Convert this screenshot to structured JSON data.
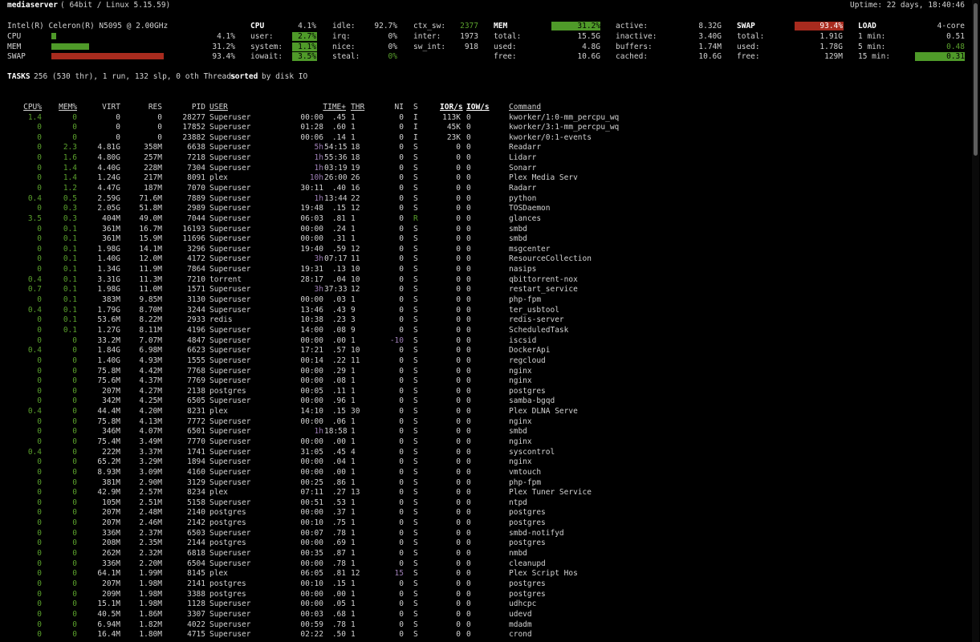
{
  "header": {
    "hostname": "mediaserver",
    "system": "( 64bit / Linux 5.15.59)",
    "uptime": "Uptime: 22 days, 18:40:46"
  },
  "quicklook": {
    "cpu_name": "Intel(R) Celeron(R) N5095 @ 2.00GHz",
    "rows": [
      {
        "label": "CPU",
        "value": "4.1%",
        "fraction": 0.041
      },
      {
        "label": "MEM",
        "value": "31.2%",
        "fraction": 0.312
      },
      {
        "label": "SWAP",
        "value": "93.4%",
        "fraction": 0.934
      }
    ]
  },
  "cpu": {
    "title": "CPU",
    "total": "4.1%",
    "user_label": "user:",
    "user": "2.7%",
    "system_label": "system:",
    "system": "1.1%",
    "iowait_label": "iowait:",
    "iowait": "3.5%",
    "idle_label": "idle:",
    "idle": "92.7%",
    "irq_label": "irq:",
    "irq": "0%",
    "nice_label": "nice:",
    "nice": "0%",
    "steal_label": "steal:",
    "steal": "0%",
    "ctx_label": "ctx_sw:",
    "ctx": "2377",
    "inter_label": "inter:",
    "inter": "1973",
    "swint_label": "sw_int:",
    "swint": "918"
  },
  "mem": {
    "title": "MEM",
    "pct": "31.2%",
    "total_label": "total:",
    "total": "15.5G",
    "used_label": "used:",
    "used": "4.8G",
    "free_label": "free:",
    "free": "10.6G",
    "active_label": "active:",
    "active": "8.32G",
    "inactive_label": "inactive:",
    "inactive": "3.40G",
    "buffers_label": "buffers:",
    "buffers": "1.74M",
    "cached_label": "cached:",
    "cached": "10.6G"
  },
  "swap": {
    "title": "SWAP",
    "pct": "93.4%",
    "total_label": "total:",
    "total": "1.91G",
    "used_label": "used:",
    "used": "1.78G",
    "free_label": "free:",
    "free": "129M"
  },
  "load": {
    "title": "LOAD",
    "cores": "4-core",
    "m1_label": "1 min:",
    "m1": "0.51",
    "m5_label": "5 min:",
    "m5": "0.48",
    "m15_label": "15 min:",
    "m15": "0.31"
  },
  "colors": {
    "green": "#5aa02c",
    "red": "#a82b1e",
    "bar_green": "#4f9a29"
  },
  "tasks": {
    "label": "TASKS",
    "summary": "256 (530 thr), 1 run, 132 slp, 0 oth Threads",
    "sorted": "sorted",
    "sort_key": "by disk IO"
  },
  "columns": [
    "CPU%",
    "MEM%",
    "VIRT",
    "RES",
    "PID",
    "USER",
    "TIME+",
    "THR",
    "NI",
    "S",
    "IOR/s",
    "IOW/s",
    "Command"
  ],
  "processes": [
    [
      "1.4",
      "0",
      "0",
      "0",
      "28277",
      "Superuser",
      "00:00",
      ".45",
      "1",
      "0",
      "I",
      "113K",
      "0",
      "kworker/1:0-mm_percpu_wq"
    ],
    [
      "0",
      "0",
      "0",
      "0",
      "17852",
      "Superuser",
      "01:28",
      ".60",
      "1",
      "0",
      "I",
      "45K",
      "0",
      "kworker/3:1-mm_percpu_wq"
    ],
    [
      "0",
      "0",
      "0",
      "0",
      "23882",
      "Superuser",
      "00:06",
      ".14",
      "1",
      "0",
      "I",
      "23K",
      "0",
      "kworker/0:1-events"
    ],
    [
      "0",
      "2.3",
      "4.81G",
      "358M",
      "6638",
      "Superuser",
      "5h",
      "54:15",
      "18",
      "0",
      "S",
      "0",
      "0",
      "Readarr"
    ],
    [
      "0",
      "1.6",
      "4.80G",
      "257M",
      "7218",
      "Superuser",
      "1h",
      "55:36",
      "18",
      "0",
      "S",
      "0",
      "0",
      "Lidarr"
    ],
    [
      "0",
      "1.4",
      "4.40G",
      "228M",
      "7304",
      "Superuser",
      "1h",
      "03:19",
      "19",
      "0",
      "S",
      "0",
      "0",
      "Sonarr"
    ],
    [
      "0",
      "1.4",
      "1.24G",
      "217M",
      "8091",
      "plex",
      "10h",
      "26:00",
      "26",
      "0",
      "S",
      "0",
      "0",
      "Plex Media Serv"
    ],
    [
      "0",
      "1.2",
      "4.47G",
      "187M",
      "7070",
      "Superuser",
      "30:11",
      ".40",
      "16",
      "0",
      "S",
      "0",
      "0",
      "Radarr"
    ],
    [
      "0.4",
      "0.5",
      "2.59G",
      "71.6M",
      "7889",
      "Superuser",
      "1h",
      "13:44",
      "22",
      "0",
      "S",
      "0",
      "0",
      "python"
    ],
    [
      "0",
      "0.3",
      "2.05G",
      "51.8M",
      "2989",
      "Superuser",
      "19:48",
      ".15",
      "12",
      "0",
      "S",
      "0",
      "0",
      "TOSDaemon"
    ],
    [
      "3.5",
      "0.3",
      "404M",
      "49.0M",
      "7044",
      "Superuser",
      "06:03",
      ".81",
      "1",
      "0",
      "R",
      "0",
      "0",
      "glances"
    ],
    [
      "0",
      "0.1",
      "361M",
      "16.7M",
      "16193",
      "Superuser",
      "00:00",
      ".24",
      "1",
      "0",
      "S",
      "0",
      "0",
      "smbd"
    ],
    [
      "0",
      "0.1",
      "361M",
      "15.9M",
      "11696",
      "Superuser",
      "00:00",
      ".31",
      "1",
      "0",
      "S",
      "0",
      "0",
      "smbd"
    ],
    [
      "0",
      "0.1",
      "1.98G",
      "14.1M",
      "3296",
      "Superuser",
      "19:40",
      ".59",
      "12",
      "0",
      "S",
      "0",
      "0",
      "msgcenter"
    ],
    [
      "0",
      "0.1",
      "1.40G",
      "12.0M",
      "4172",
      "Superuser",
      "3h",
      "07:17",
      "11",
      "0",
      "S",
      "0",
      "0",
      "ResourceCollection"
    ],
    [
      "0",
      "0.1",
      "1.34G",
      "11.9M",
      "7864",
      "Superuser",
      "19:31",
      ".13",
      "10",
      "0",
      "S",
      "0",
      "0",
      "nasips"
    ],
    [
      "0.4",
      "0.1",
      "3.31G",
      "11.3M",
      "7210",
      "torrent",
      "28:17",
      ".04",
      "10",
      "0",
      "S",
      "0",
      "0",
      "qbittorrent-nox"
    ],
    [
      "0.7",
      "0.1",
      "1.98G",
      "11.0M",
      "1571",
      "Superuser",
      "3h",
      "37:33",
      "12",
      "0",
      "S",
      "0",
      "0",
      "restart_service"
    ],
    [
      "0",
      "0.1",
      "383M",
      "9.85M",
      "3130",
      "Superuser",
      "00:00",
      ".03",
      "1",
      "0",
      "S",
      "0",
      "0",
      "php-fpm"
    ],
    [
      "0.4",
      "0.1",
      "1.79G",
      "8.70M",
      "3244",
      "Superuser",
      "13:46",
      ".43",
      "9",
      "0",
      "S",
      "0",
      "0",
      "ter_usbtool"
    ],
    [
      "0",
      "0.1",
      "53.6M",
      "8.22M",
      "2933",
      "redis",
      "10:38",
      ".23",
      "3",
      "0",
      "S",
      "0",
      "0",
      "redis-server"
    ],
    [
      "0",
      "0.1",
      "1.27G",
      "8.11M",
      "4196",
      "Superuser",
      "14:00",
      ".08",
      "9",
      "0",
      "S",
      "0",
      "0",
      "ScheduledTask"
    ],
    [
      "0",
      "0",
      "33.2M",
      "7.07M",
      "4847",
      "Superuser",
      "00:00",
      ".00",
      "1",
      "-10",
      "S",
      "0",
      "0",
      "iscsid"
    ],
    [
      "0.4",
      "0",
      "1.84G",
      "6.98M",
      "6623",
      "Superuser",
      "17:21",
      ".57",
      "10",
      "0",
      "S",
      "0",
      "0",
      "DockerApi"
    ],
    [
      "0",
      "0",
      "1.40G",
      "4.93M",
      "1555",
      "Superuser",
      "00:14",
      ".22",
      "11",
      "0",
      "S",
      "0",
      "0",
      "regcloud"
    ],
    [
      "0",
      "0",
      "75.8M",
      "4.42M",
      "7768",
      "Superuser",
      "00:00",
      ".29",
      "1",
      "0",
      "S",
      "0",
      "0",
      "nginx"
    ],
    [
      "0",
      "0",
      "75.6M",
      "4.37M",
      "7769",
      "Superuser",
      "00:00",
      ".08",
      "1",
      "0",
      "S",
      "0",
      "0",
      "nginx"
    ],
    [
      "0",
      "0",
      "207M",
      "4.27M",
      "2138",
      "postgres",
      "00:05",
      ".11",
      "1",
      "0",
      "S",
      "0",
      "0",
      "postgres"
    ],
    [
      "0",
      "0",
      "342M",
      "4.25M",
      "6505",
      "Superuser",
      "00:00",
      ".96",
      "1",
      "0",
      "S",
      "0",
      "0",
      "samba-bgqd"
    ],
    [
      "0.4",
      "0",
      "44.4M",
      "4.20M",
      "8231",
      "plex",
      "14:10",
      ".15",
      "30",
      "0",
      "S",
      "0",
      "0",
      "Plex DLNA Serve"
    ],
    [
      "0",
      "0",
      "75.8M",
      "4.13M",
      "7772",
      "Superuser",
      "00:00",
      ".06",
      "1",
      "0",
      "S",
      "0",
      "0",
      "nginx"
    ],
    [
      "0",
      "0",
      "346M",
      "4.07M",
      "6501",
      "Superuser",
      "1h",
      "18:58",
      "1",
      "0",
      "S",
      "0",
      "0",
      "smbd"
    ],
    [
      "0",
      "0",
      "75.4M",
      "3.49M",
      "7770",
      "Superuser",
      "00:00",
      ".00",
      "1",
      "0",
      "S",
      "0",
      "0",
      "nginx"
    ],
    [
      "0.4",
      "0",
      "222M",
      "3.37M",
      "1741",
      "Superuser",
      "31:05",
      ".45",
      "4",
      "0",
      "S",
      "0",
      "0",
      "syscontrol"
    ],
    [
      "0",
      "0",
      "65.2M",
      "3.29M",
      "1894",
      "Superuser",
      "00:00",
      ".04",
      "1",
      "0",
      "S",
      "0",
      "0",
      "nginx"
    ],
    [
      "0",
      "0",
      "8.93M",
      "3.09M",
      "4160",
      "Superuser",
      "00:00",
      ".00",
      "1",
      "0",
      "S",
      "0",
      "0",
      "vmtouch"
    ],
    [
      "0",
      "0",
      "381M",
      "2.90M",
      "3129",
      "Superuser",
      "00:25",
      ".86",
      "1",
      "0",
      "S",
      "0",
      "0",
      "php-fpm"
    ],
    [
      "0",
      "0",
      "42.9M",
      "2.57M",
      "8234",
      "plex",
      "07:11",
      ".27",
      "13",
      "0",
      "S",
      "0",
      "0",
      "Plex Tuner Service"
    ],
    [
      "0",
      "0",
      "105M",
      "2.51M",
      "5158",
      "Superuser",
      "00:51",
      ".53",
      "1",
      "0",
      "S",
      "0",
      "0",
      "ntpd"
    ],
    [
      "0",
      "0",
      "207M",
      "2.48M",
      "2140",
      "postgres",
      "00:00",
      ".37",
      "1",
      "0",
      "S",
      "0",
      "0",
      "postgres"
    ],
    [
      "0",
      "0",
      "207M",
      "2.46M",
      "2142",
      "postgres",
      "00:10",
      ".75",
      "1",
      "0",
      "S",
      "0",
      "0",
      "postgres"
    ],
    [
      "0",
      "0",
      "336M",
      "2.37M",
      "6503",
      "Superuser",
      "00:07",
      ".78",
      "1",
      "0",
      "S",
      "0",
      "0",
      "smbd-notifyd"
    ],
    [
      "0",
      "0",
      "208M",
      "2.35M",
      "2144",
      "postgres",
      "00:00",
      ".69",
      "1",
      "0",
      "S",
      "0",
      "0",
      "postgres"
    ],
    [
      "0",
      "0",
      "262M",
      "2.32M",
      "6818",
      "Superuser",
      "00:35",
      ".87",
      "1",
      "0",
      "S",
      "0",
      "0",
      "nmbd"
    ],
    [
      "0",
      "0",
      "336M",
      "2.20M",
      "6504",
      "Superuser",
      "00:00",
      ".78",
      "1",
      "0",
      "S",
      "0",
      "0",
      "cleanupd"
    ],
    [
      "0",
      "0",
      "64.1M",
      "1.99M",
      "8145",
      "plex",
      "06:05",
      ".81",
      "12",
      "15",
      "S",
      "0",
      "0",
      "Plex Script Hos"
    ],
    [
      "0",
      "0",
      "207M",
      "1.98M",
      "2141",
      "postgres",
      "00:10",
      ".15",
      "1",
      "0",
      "S",
      "0",
      "0",
      "postgres"
    ],
    [
      "0",
      "0",
      "209M",
      "1.98M",
      "3388",
      "postgres",
      "00:00",
      ".00",
      "1",
      "0",
      "S",
      "0",
      "0",
      "postgres"
    ],
    [
      "0",
      "0",
      "15.1M",
      "1.98M",
      "1128",
      "Superuser",
      "00:00",
      ".05",
      "1",
      "0",
      "S",
      "0",
      "0",
      "udhcpc"
    ],
    [
      "0",
      "0",
      "40.5M",
      "1.86M",
      "3307",
      "Superuser",
      "00:03",
      ".68",
      "1",
      "0",
      "S",
      "0",
      "0",
      "udevd"
    ],
    [
      "0",
      "0",
      "6.94M",
      "1.82M",
      "4022",
      "Superuser",
      "00:59",
      ".78",
      "1",
      "0",
      "S",
      "0",
      "0",
      "mdadm"
    ],
    [
      "0",
      "0",
      "16.4M",
      "1.80M",
      "4715",
      "Superuser",
      "02:22",
      ".50",
      "1",
      "0",
      "S",
      "0",
      "0",
      "crond"
    ]
  ]
}
